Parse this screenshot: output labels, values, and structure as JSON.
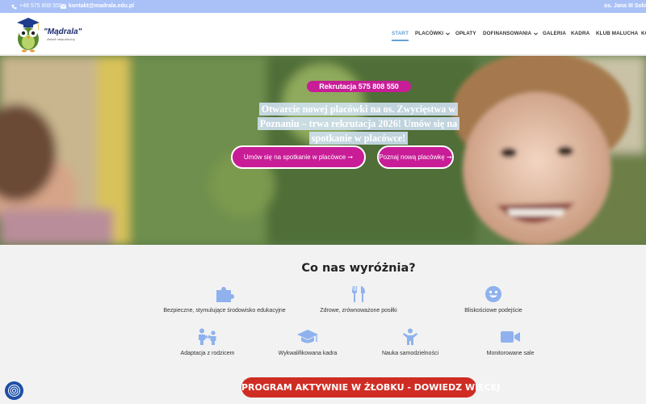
{
  "topbar": {
    "phone": "+48 575 808 550",
    "email": "kontakt@madrala.edu.pl",
    "location": "os. Jana III Sobies"
  },
  "logo": {
    "name": "\"Mądrala\"",
    "subtitle": "żłobek niepubliczny"
  },
  "nav": {
    "items": [
      {
        "label": "START",
        "active": true,
        "dropdown": false
      },
      {
        "label": "PLACÓWKI",
        "active": false,
        "dropdown": true
      },
      {
        "label": "OPŁATY",
        "active": false,
        "dropdown": false
      },
      {
        "label": "DOFINANSOWANIA",
        "active": false,
        "dropdown": true
      },
      {
        "label": "GALERIA",
        "active": false,
        "dropdown": false
      },
      {
        "label": "KADRA",
        "active": false,
        "dropdown": false
      },
      {
        "label": "KLUB MALUCHA",
        "active": false,
        "dropdown": false
      },
      {
        "label": "KO",
        "active": false,
        "dropdown": false
      }
    ]
  },
  "hero": {
    "badge": "Rekrutacja 575 808 550",
    "headline": "Otwarcie nowej placówki na os. Zwycięstwa w Poznaniu – trwa rekrutacja 2026! Umów się na spotkanie w placówce!",
    "cta_primary": "Umów się na spotkanie w placówce ➞",
    "cta_secondary": "Poznaj nową placówkę ➞"
  },
  "features": {
    "title": "Co nas wyróżnia?",
    "items": [
      {
        "label": "Bezpieczne, stymulujące środowisko edukacyjne",
        "icon": "puzzle-icon"
      },
      {
        "label": "Zdrowe, zrównoważone posiłki",
        "icon": "cutlery-icon"
      },
      {
        "label": "Bliskościowe podejście",
        "icon": "smile-icon"
      },
      {
        "label": "Adaptacja z rodzicem",
        "icon": "parent-child-icon"
      },
      {
        "label": "Wykwalifikowana kadra",
        "icon": "graduation-cap-icon"
      },
      {
        "label": "Nauka samodzielności",
        "icon": "child-icon"
      },
      {
        "label": "Monitorowane sale",
        "icon": "video-camera-icon"
      }
    ]
  },
  "program_button": "PROGRAM AKTYWNIE W ŻŁOBKU - DOWIEDZ WIĘCEJ",
  "colors": {
    "topbar": "#a9c1f7",
    "accent_pink": "#c81d97",
    "icon_blue": "#8fb2ee",
    "program_red": "#cf2d24",
    "nav_active": "#69a1d6"
  }
}
